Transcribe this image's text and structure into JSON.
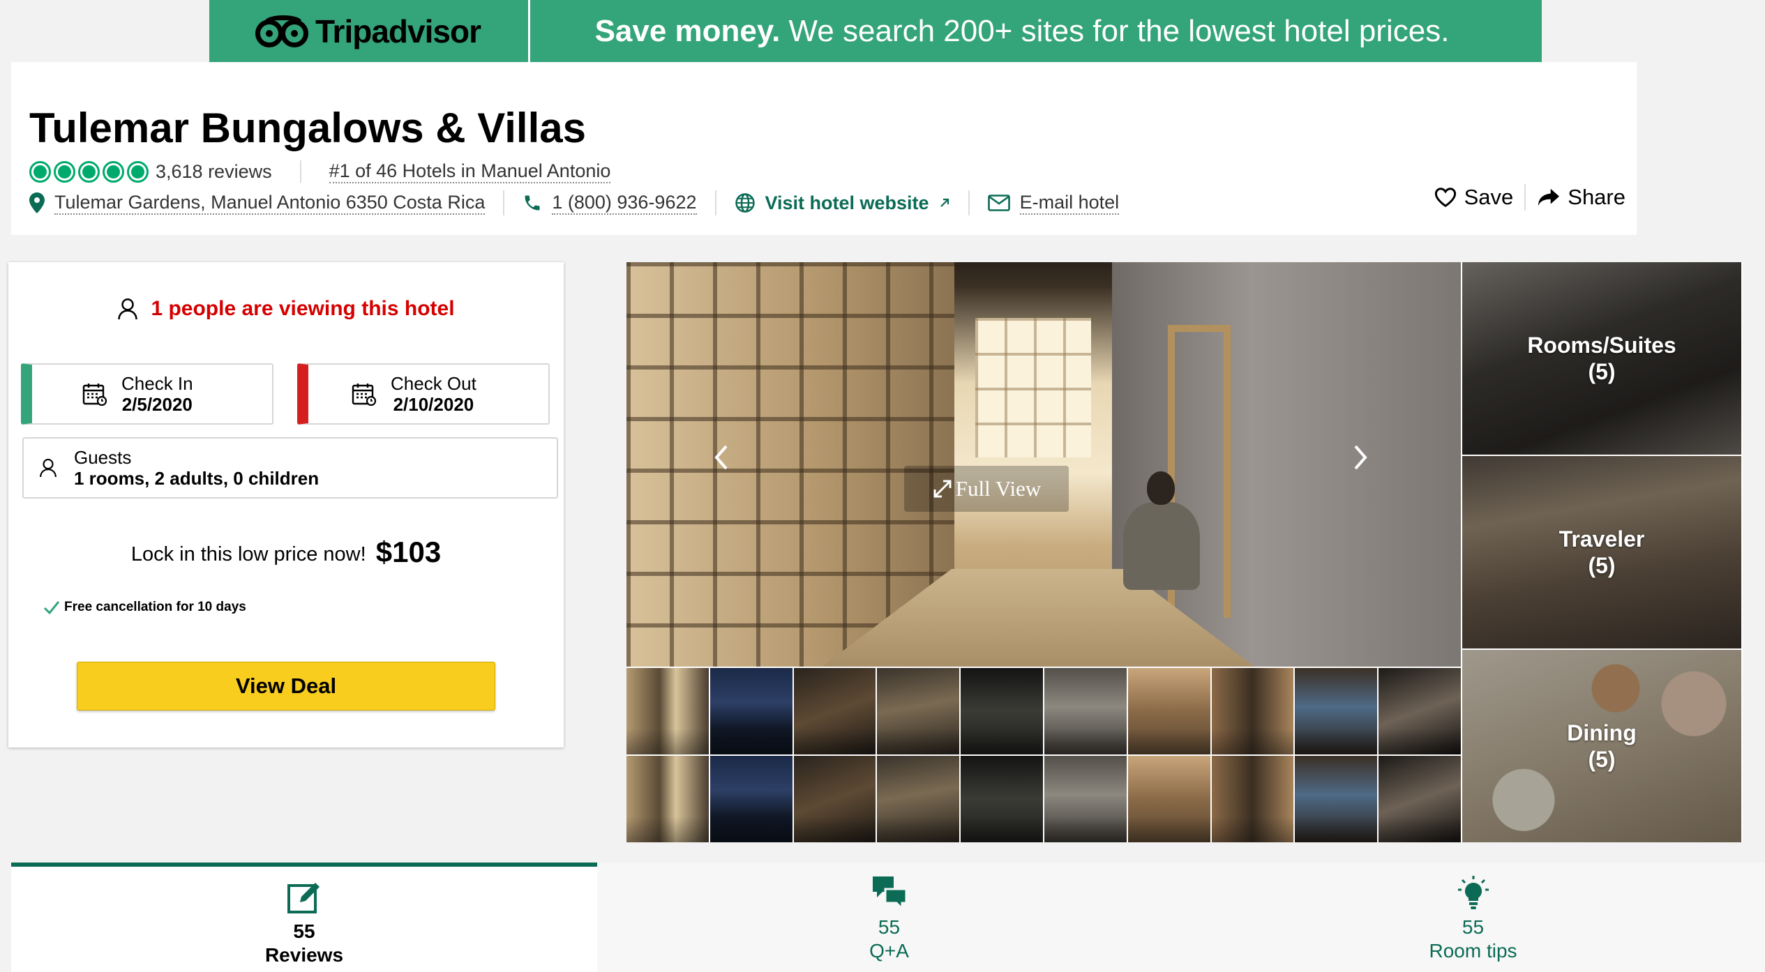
{
  "banner": {
    "logo_text": "Tripadvisor",
    "message_bold": "Save money.",
    "message_rest": " We search 200+ sites for the lowest hotel prices.",
    "color": "#34a47a"
  },
  "hotel": {
    "name": "Tulemar Bungalows & Villas",
    "rating_bubbles": 5,
    "reviews_count": "3,618 reviews",
    "ranking": "#1 of 46 Hotels in Manuel Antonio",
    "address": "Tulemar Gardens, Manuel Antonio 6350 Costa Rica",
    "phone": "1 (800) 936-9622",
    "website_label": "Visit hotel website",
    "email_label": "E-mail hotel"
  },
  "actions": {
    "save_label": "Save",
    "share_label": "Share"
  },
  "booking": {
    "viewing_text": "1 people are viewing this hotel",
    "check_in_label": "Check In",
    "check_in_value": "2/5/2020",
    "check_out_label": "Check Out",
    "check_out_value": "2/10/2020",
    "guests_label": "Guests",
    "guests_value": "1 rooms, 2 adults, 0 children",
    "lock_text": "Lock in this low price now!",
    "price": "$103",
    "free_cancellation": "Free cancellation for 10 days",
    "view_deal_label": "View Deal"
  },
  "gallery": {
    "full_view_label": "Full View",
    "thumbnails_count": 20,
    "categories": [
      {
        "label": "Rooms/Suites",
        "count": "(5)"
      },
      {
        "label": "Traveler",
        "count": "(5)"
      },
      {
        "label": "Dining",
        "count": "(5)"
      }
    ]
  },
  "tabs": [
    {
      "count": "55",
      "label": "Reviews",
      "icon": "edit-review-icon",
      "active": true
    },
    {
      "count": "55",
      "label": "Q+A",
      "icon": "chat-bubbles-icon",
      "active": false
    },
    {
      "count": "55",
      "label": "Room tips",
      "icon": "lightbulb-icon",
      "active": false
    }
  ],
  "colors": {
    "accent_green": "#0b6b55",
    "rating_green": "#00aa6c",
    "alert_red": "#d50000",
    "deal_yellow": "#f8cd1e",
    "check_out_red": "#d51f1f"
  }
}
